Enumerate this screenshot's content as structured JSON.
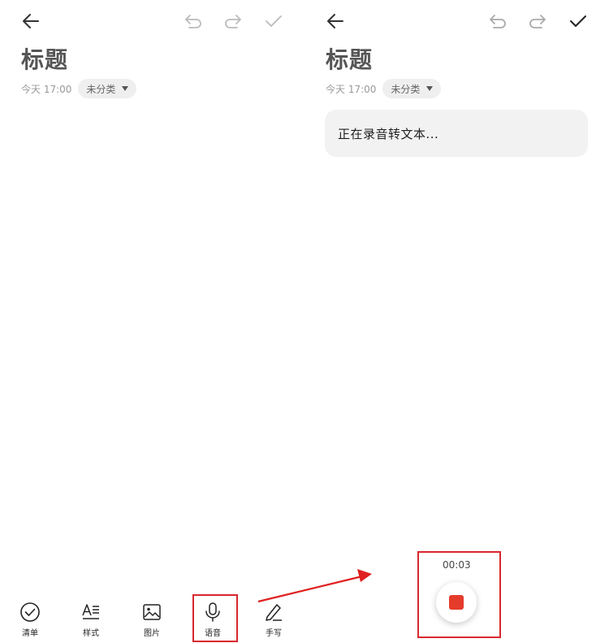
{
  "colors": {
    "highlight": "#d9272e",
    "record_stop": "#e53b2b"
  },
  "left": {
    "header": {
      "back_icon": "arrow-left-icon",
      "undo_icon": "undo-icon",
      "redo_icon": "redo-icon",
      "confirm_icon": "check-icon"
    },
    "title": "标题",
    "date": "今天 17:00",
    "category": "未分类",
    "toolbar": [
      {
        "label": "清单",
        "icon": "checklist-icon"
      },
      {
        "label": "样式",
        "icon": "text-style-icon"
      },
      {
        "label": "图片",
        "icon": "image-icon"
      },
      {
        "label": "语音",
        "icon": "microphone-icon"
      },
      {
        "label": "手写",
        "icon": "pen-icon"
      }
    ]
  },
  "right": {
    "header": {
      "back_icon": "arrow-left-icon",
      "undo_icon": "undo-icon",
      "redo_icon": "redo-icon",
      "confirm_icon": "check-icon"
    },
    "title": "标题",
    "date": "今天 17:00",
    "category": "未分类",
    "transcribe_text": "正在录音转文本...",
    "recording_time": "00:03",
    "stop_icon": "stop-icon"
  }
}
